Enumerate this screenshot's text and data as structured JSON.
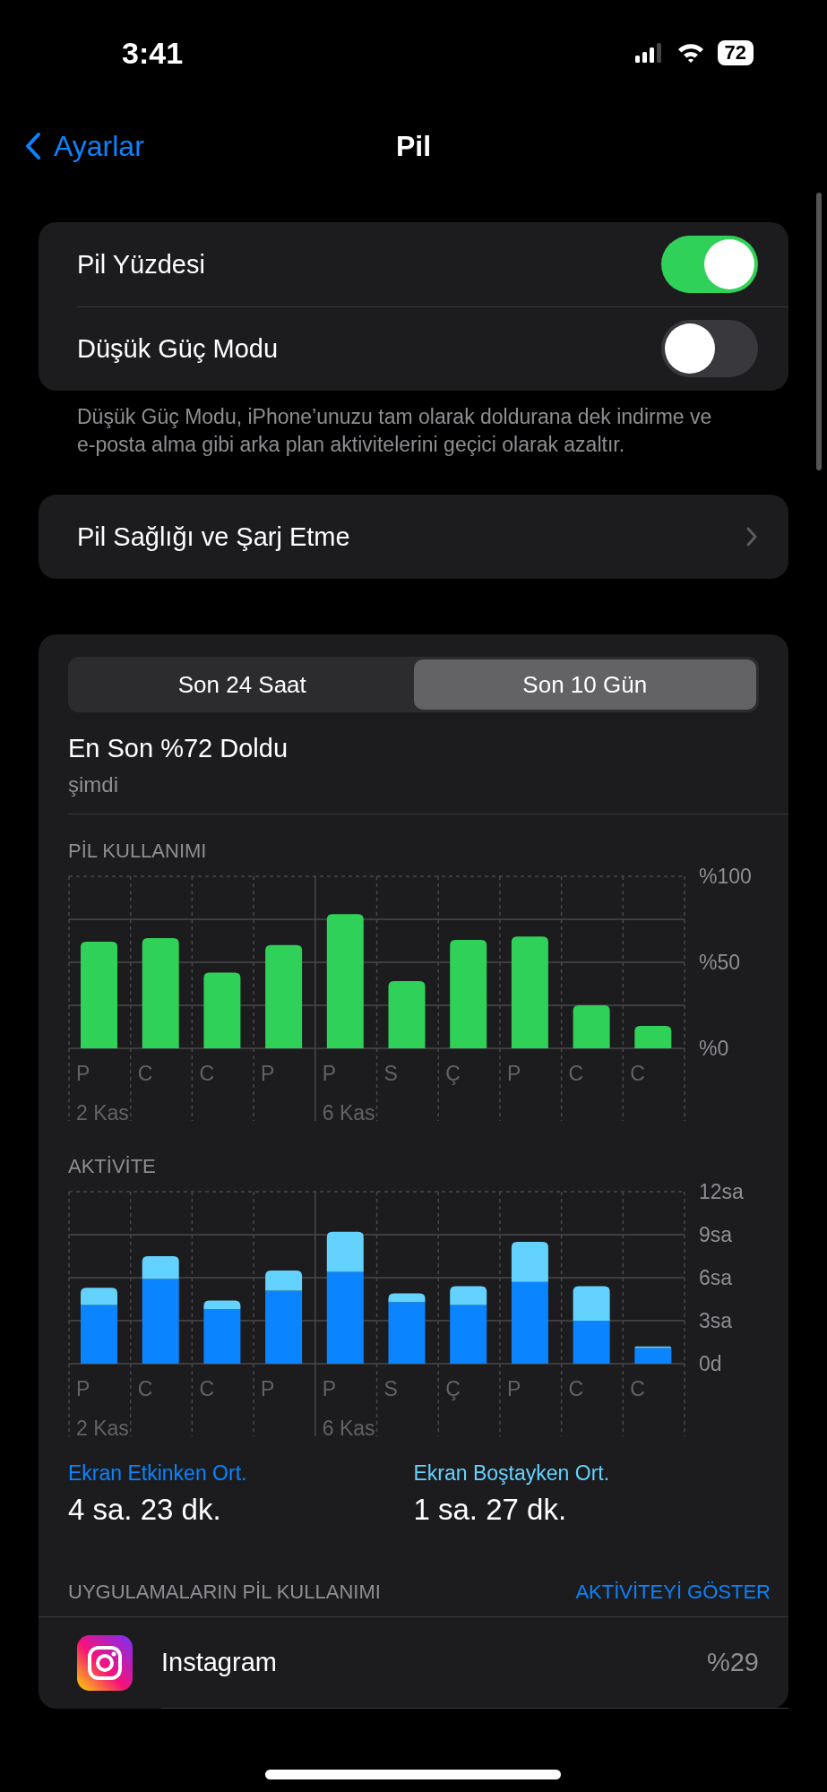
{
  "status_bar": {
    "time": "3:41",
    "battery": "72"
  },
  "nav": {
    "back": "Ayarlar",
    "title": "Pil"
  },
  "groups": [
    {
      "rows": [
        {
          "kind": "toggle",
          "label": "Pil Yüzdesi",
          "on": true
        },
        {
          "kind": "toggle",
          "label": "Düşük Güç Modu",
          "on": false
        }
      ],
      "footer": "Düşük Güç Modu, iPhone’unuzu tam olarak doldurana dek indirme ve e-posta alma gibi arka plan aktivitelerini geçici olarak azaltır."
    },
    {
      "rows": [
        {
          "kind": "link",
          "label": "Pil Sağlığı ve Şarj Etme"
        }
      ]
    }
  ],
  "usage": {
    "tabs": [
      {
        "label": "Son 24 Saat",
        "selected": false
      },
      {
        "label": "Son 10 Gün",
        "selected": true
      }
    ],
    "last_charge": {
      "title": "En Son %72 Doldu",
      "time": "şimdi"
    },
    "charts": [
      {
        "chart_data": {
          "type": "bar",
          "title": "PİL KULLANIMI",
          "categories": [
            "P",
            "C",
            "C",
            "P",
            "P",
            "S",
            "Ç",
            "P",
            "C",
            "C"
          ],
          "values": [
            62,
            64,
            44,
            60,
            78,
            39,
            63,
            65,
            25,
            13
          ],
          "grid": true,
          "ylim": [
            0,
            100
          ],
          "yticks": [
            {
              "value": 0,
              "label": "%0"
            },
            {
              "value": 50,
              "label": "%50"
            },
            {
              "value": 100,
              "label": "%100"
            }
          ],
          "annotations": [
            "2 Kas",
            "6 Kas"
          ]
        }
      },
      {
        "chart_data": {
          "type": "bar",
          "title": "AKTİVİTE",
          "stacked": true,
          "grid": true,
          "categories": [
            "P",
            "C",
            "C",
            "P",
            "P",
            "S",
            "Ç",
            "P",
            "C",
            "C"
          ],
          "series": [
            {
              "color": "#0a84ff",
              "values": [
                4.1,
                5.9,
                3.8,
                5.1,
                6.4,
                4.3,
                4.1,
                5.7,
                3.0,
                1.1
              ]
            },
            {
              "color": "#64d2ff",
              "values": [
                1.2,
                1.6,
                0.6,
                1.4,
                2.8,
                0.6,
                1.3,
                2.8,
                2.4,
                0.1
              ]
            }
          ],
          "ylim": [
            0,
            12
          ],
          "yticks": [
            {
              "value": 0,
              "label": "0d"
            },
            {
              "value": 3,
              "label": "3sa"
            },
            {
              "value": 6,
              "label": "6sa"
            },
            {
              "value": 9,
              "label": "9sa"
            },
            {
              "value": 12,
              "label": "12sa"
            }
          ],
          "annotations": [
            "2 Kas",
            "6 Kas"
          ]
        }
      }
    ],
    "averages": [
      {
        "label": "Ekran Etkinken Ort.",
        "value": "4 sa. 23 dk.",
        "color": "#0a84ff"
      },
      {
        "label": "Ekran Boştayken Ort.",
        "value": "1 sa. 27 dk.",
        "color": "#64d2ff"
      }
    ],
    "apps_header": "UYGULAMALARIN PİL KULLANIMI",
    "show_activity": "AKTİVİTEYİ GÖSTER",
    "apps": [
      {
        "name": "Instagram",
        "value": "%29"
      }
    ]
  }
}
